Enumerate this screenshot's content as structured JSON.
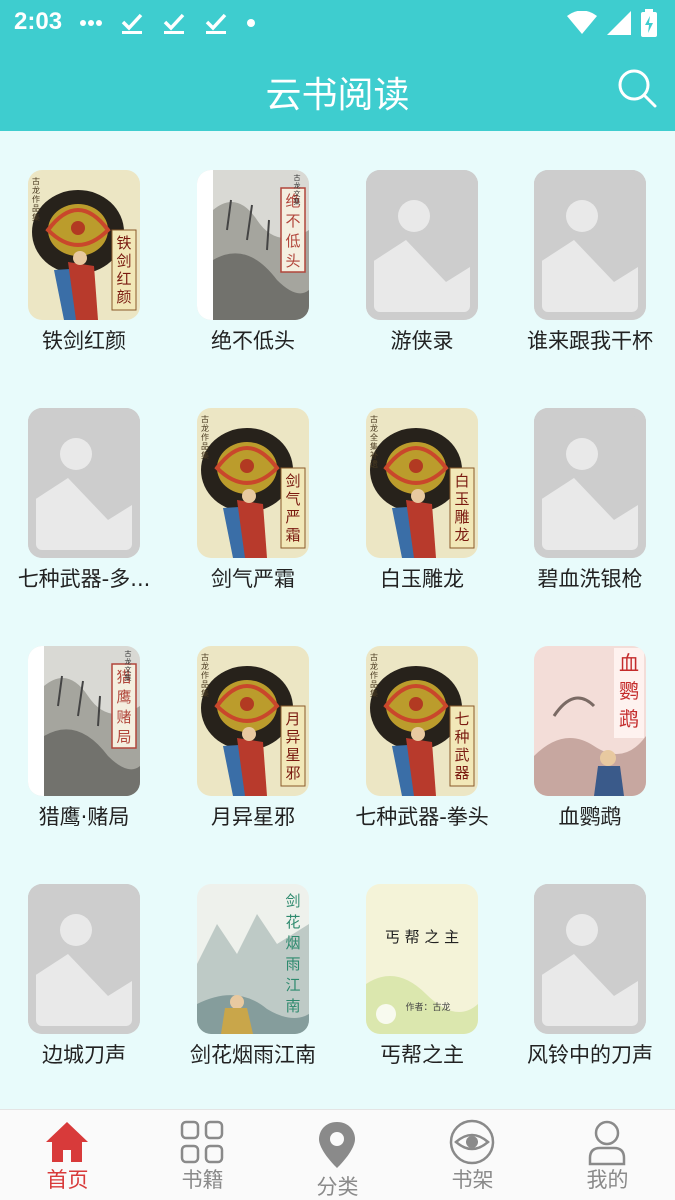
{
  "status_bar": {
    "time": "2:03"
  },
  "app_bar": {
    "title": "云书阅读"
  },
  "books": [
    {
      "title": "铁剑红颜",
      "cover": "dragon"
    },
    {
      "title": "绝不低头",
      "cover": "ink"
    },
    {
      "title": "游侠录",
      "cover": "placeholder"
    },
    {
      "title": "谁来跟我干杯",
      "cover": "placeholder"
    },
    {
      "title": "七种武器-多...",
      "cover": "placeholder"
    },
    {
      "title": "剑气严霜",
      "cover": "dragon"
    },
    {
      "title": "白玉雕龙",
      "cover": "dragon"
    },
    {
      "title": "碧血洗银枪",
      "cover": "placeholder"
    },
    {
      "title": "猎鹰·赌局",
      "cover": "ink"
    },
    {
      "title": "月异星邪",
      "cover": "dragon"
    },
    {
      "title": "七种武器-拳头",
      "cover": "dragon"
    },
    {
      "title": "血鹦鹉",
      "cover": "pink"
    },
    {
      "title": "边城刀声",
      "cover": "placeholder"
    },
    {
      "title": "剑花烟雨江南",
      "cover": "landscape"
    },
    {
      "title": "丐帮之主",
      "cover": "light"
    },
    {
      "title": "风铃中的刀声",
      "cover": "placeholder"
    }
  ],
  "covers": {
    "b0": {
      "vertical_text": "铁剑红颜",
      "side_text": "古龙作品集"
    },
    "b1": {
      "vertical_text": "绝不低头",
      "side_text": "古龙文集"
    },
    "b5": {
      "vertical_text": "剑气严霜",
      "side_text": "古龙作品集"
    },
    "b6": {
      "vertical_text": "白玉雕龙",
      "side_text": "古龙全集补遗"
    },
    "b8": {
      "vertical_text": "猎鹰赌局",
      "side_text": "古龙文集"
    },
    "b9": {
      "vertical_text": "月异星邪",
      "side_text": "古龙作品集"
    },
    "b10": {
      "vertical_text": "七种武器",
      "side_text": "古龙作品集"
    },
    "b11": {
      "vertical_text": "血鹦鹉"
    },
    "b13": {
      "vertical_text": "剑花烟雨江南"
    },
    "b14": {
      "vertical_text": "丐帮之主",
      "author": "作者：古龙"
    }
  },
  "bottom_nav": [
    {
      "label": "首页",
      "icon": "home-icon",
      "active": true
    },
    {
      "label": "书籍",
      "icon": "grid-icon",
      "active": false
    },
    {
      "label": "分类",
      "icon": "location-pin-icon",
      "active": false
    },
    {
      "label": "书架",
      "icon": "eye-icon",
      "active": false
    },
    {
      "label": "我的",
      "icon": "person-icon",
      "active": false
    }
  ],
  "colors": {
    "accent": "#3ecdcf",
    "background": "#e8fbfb",
    "nav_active": "#d83a3a",
    "nav_inactive": "#8a8a8a",
    "placeholder": "#cdcdcd"
  }
}
